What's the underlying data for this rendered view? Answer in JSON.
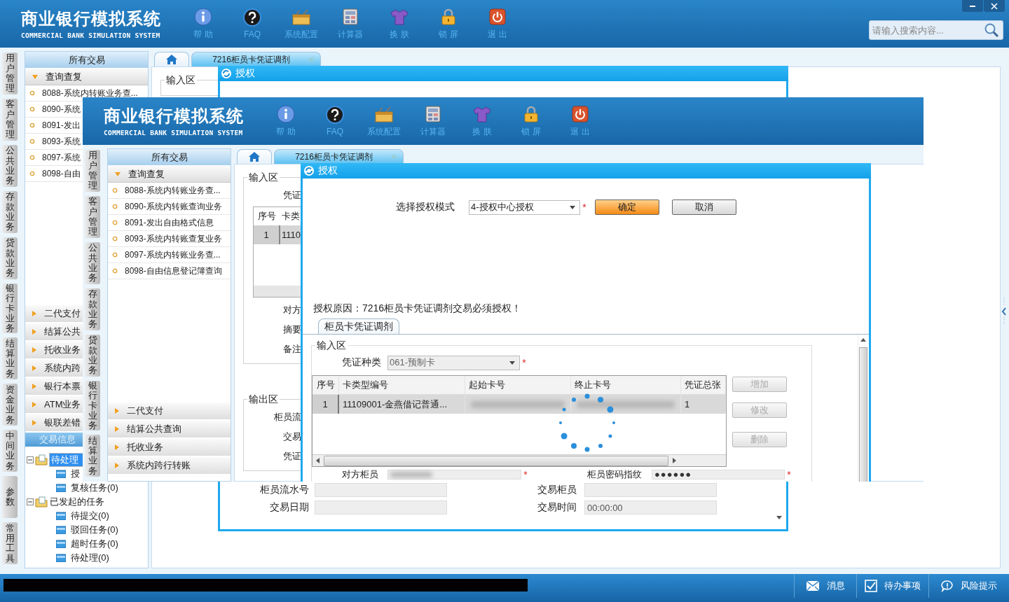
{
  "app": {
    "header": {
      "title": "商业银行模拟系统",
      "subtitle": "COMMERCIAL BANK SIMULATION SYSTEM",
      "toolbar": [
        {
          "kind": "help",
          "label": "帮 助"
        },
        {
          "kind": "faq",
          "label": "FAQ"
        },
        {
          "kind": "config",
          "label": "系统配置"
        },
        {
          "kind": "calculator",
          "label": "计算器"
        },
        {
          "kind": "skin",
          "label": "换 肤"
        },
        {
          "kind": "lock",
          "label": "锁 屏"
        },
        {
          "kind": "exit",
          "label": "退 出"
        }
      ],
      "window_buttons": [
        {
          "kind": "minimize"
        },
        {
          "kind": "close"
        }
      ],
      "search": {
        "placeholder": "请输入搜索内容..."
      }
    },
    "side_tabs": [
      "用户管理",
      "客户管理",
      "公共业务",
      "存款业务",
      "贷款业务",
      "银行卡业务",
      "结算业务",
      "资金业务",
      "中间业务",
      "参数",
      "常用工具"
    ],
    "nav": {
      "title": "所有交易",
      "open_group": {
        "label": "查询查复",
        "expanded": true
      },
      "items": [
        "8088-系统内转账业务查...",
        "8090-系统",
        "8091-发出",
        "8093-系统",
        "8097-系统",
        "8098-自由"
      ],
      "groups": [
        {
          "label": "二代支付",
          "expanded": false
        },
        {
          "label": "结算公共",
          "expanded": false
        },
        {
          "label": "托收业务",
          "expanded": false
        },
        {
          "label": "系统内跨",
          "expanded": false
        },
        {
          "label": "银行本票",
          "expanded": false
        },
        {
          "label": "ATM业务",
          "expanded": false
        },
        {
          "label": "银联差错",
          "expanded": false
        }
      ],
      "info_title": "交易信息",
      "tree": [
        {
          "label": "待处理",
          "expanded": true,
          "selected": true,
          "children": [
            {
              "label": "授",
              "selected": false
            },
            {
              "label": "复核任务(0)",
              "selected": false
            }
          ]
        },
        {
          "label": "已发起的任务",
          "expanded": true,
          "selected": false,
          "children": [
            {
              "label": "待提交(0)",
              "selected": false
            },
            {
              "label": "驳回任务(0)",
              "selected": false
            },
            {
              "label": "超时任务(0)",
              "selected": false
            },
            {
              "label": "待处理(0)",
              "selected": false
            }
          ]
        }
      ]
    },
    "tabs": [
      {
        "kind": "home",
        "selected": false
      },
      {
        "kind": "page",
        "label": "7216柜员卡凭证调剂",
        "selected": true
      }
    ],
    "form": [
      {
        "legend": "输入区"
      }
    ],
    "dialog": {
      "title": "授权",
      "bottom_rows": [
        {
          "fields": [
            {
              "label": "柜员流水号"
            },
            {
              "label": "交易柜员"
            }
          ]
        },
        {
          "fields": [
            {
              "label": "交易日期"
            },
            {
              "label": "交易时间",
              "value": "00:00:00"
            }
          ]
        }
      ]
    },
    "collapse_handle": true,
    "status_bar": {
      "redaction": true,
      "items": [
        {
          "kind": "message",
          "label": "消息"
        },
        {
          "kind": "todo",
          "label": "待办事项"
        },
        {
          "kind": "risk",
          "label": "风险提示"
        }
      ]
    }
  },
  "pasted_screenshot": {
    "header": {
      "title": "商业银行模拟系统",
      "subtitle": "COMMERCIAL BANK SIMULATION SYSTEM",
      "toolbar": [
        {
          "kind": "help",
          "label": "帮 助"
        },
        {
          "kind": "faq",
          "label": "FAQ"
        },
        {
          "kind": "config",
          "label": "系统配置"
        },
        {
          "kind": "calculator",
          "label": "计算器"
        },
        {
          "kind": "skin",
          "label": "换 肤"
        },
        {
          "kind": "lock",
          "label": "锁 屏"
        },
        {
          "kind": "exit",
          "label": "退 出"
        }
      ]
    },
    "side_tabs": [
      "用户管理",
      "客户管理",
      "公共业务",
      "存款业务",
      "贷款业务",
      "银行卡业务",
      "结算业务"
    ],
    "nav": {
      "title": "所有交易",
      "open_group": {
        "label": "查询查复",
        "expanded": true
      },
      "items": [
        "8088-系统内转账业务查...",
        "8090-系统内转账查询业务",
        "8091-发出自由格式信息",
        "8093-系统内转账查复业务",
        "8097-系统内转账业务查...",
        "8098-自由信息登记簿查询"
      ],
      "groups": [
        {
          "label": "二代支付",
          "expanded": false
        },
        {
          "label": "结算公共查询",
          "expanded": false
        },
        {
          "label": "托收业务",
          "expanded": false
        },
        {
          "label": "系统内跨行转账",
          "expanded": false
        }
      ]
    },
    "tabs": [
      {
        "kind": "home",
        "selected": false
      },
      {
        "kind": "page",
        "label": "7216柜员卡凭证调剂",
        "selected": true
      }
    ],
    "form": [
      {
        "legend": "输入区",
        "rows": [
          {
            "kind": "label",
            "text": "凭证"
          },
          {
            "kind": "table",
            "columns": [
              "序号",
              "卡类"
            ],
            "rows": [
              [
                "1",
                "1110"
              ]
            ]
          },
          {
            "kind": "label",
            "text": "对方"
          },
          {
            "kind": "label",
            "text": "摘要"
          },
          {
            "kind": "label",
            "text": "备注"
          }
        ]
      },
      {
        "legend": "输出区",
        "rows": [
          {
            "kind": "label",
            "text": "柜员流"
          },
          {
            "kind": "label",
            "text": "交易"
          },
          {
            "kind": "label",
            "text": "凭证"
          }
        ]
      }
    ],
    "dialog": {
      "title": "授权",
      "mode": {
        "label": "选择授权模式",
        "value": "4-授权中心授权",
        "required_mark": "*"
      },
      "buttons": [
        {
          "kind": "primary",
          "label": "确定"
        },
        {
          "kind": "normal",
          "label": "取消"
        }
      ],
      "reason": "授权原因：7216柜员卡凭证调剂交易必须授权！",
      "sub_tabs": [
        {
          "label": "柜员卡凭证调剂",
          "selected": true
        }
      ],
      "input_group": {
        "legend": "输入区",
        "voucher": {
          "label": "凭证种类",
          "value": "061-预制卡",
          "required_mark": "*"
        },
        "table": {
          "columns": [
            "序号",
            "卡类型编号",
            "起始卡号",
            "终止卡号",
            "凭证总张"
          ],
          "rows": [
            [
              {
                "kind": "text",
                "text": "1"
              },
              {
                "kind": "text",
                "text": "11109001-金燕借记普通..."
              },
              {
                "kind": "redacted"
              },
              {
                "kind": "redacted"
              },
              {
                "kind": "text",
                "text": "1"
              }
            ]
          ]
        },
        "actions": [
          {
            "label": "增加",
            "disabled": true
          },
          {
            "label": "修改",
            "disabled": true
          },
          {
            "label": "删除",
            "disabled": true
          }
        ],
        "fields": [
          {
            "label": "对方柜员",
            "redacted": true,
            "required_mark": "*"
          },
          {
            "label": "柜员密码指纹",
            "value": "●●●●●●",
            "required_mark": "*"
          }
        ]
      },
      "loading": true
    }
  }
}
